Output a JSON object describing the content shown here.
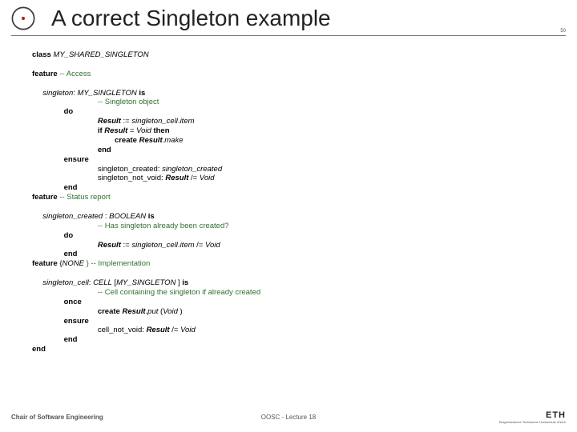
{
  "pagenum": "50",
  "title": "A correct Singleton example",
  "code": {
    "l1a": "class",
    "l1b": " MY_SHARED_SINGLETON",
    "l2a": "feature",
    "l2b": " -- Access",
    "l3a": "singleton",
    "l3b": ": ",
    "l3c": "MY_SINGLETON",
    "l3d": " ",
    "l3e": "is",
    "c1": "-- Singleton object",
    "do1": "do",
    "r1a": "Result",
    "r1b": " := ",
    "r1c": "singleton_cell",
    "r1d": ".",
    "r1e": "item",
    "r2a": "if",
    "r2b": " ",
    "r2c": "Result",
    "r2d": " = ",
    "r2e": "Void",
    "r2f": " ",
    "r2g": "then",
    "r3a": "create",
    "r3b": " ",
    "r3c": "Result",
    "r3d": ".",
    "r3e": "make",
    "r4": "end",
    "ens1": "ensure",
    "e1a": "singleton_created: ",
    "e1b": "singleton_created",
    "e2a": "singleton_not_void: ",
    "e2b": "Result",
    "e2c": " /= ",
    "e2d": "Void",
    "end1": "end",
    "f2a": "feature",
    "f2b": " -- Status report",
    "sc1a": "singleton_created",
    "sc1b": " : ",
    "sc1c": "BOOLEAN",
    "sc1d": " ",
    "sc1e": "is",
    "c2": "-- Has singleton already been created?",
    "do2": "do",
    "r5a": "Result",
    "r5b": " := ",
    "r5c": "singleton_cell",
    "r5d": ".",
    "r5e": "item",
    "r5f": " /= ",
    "r5g": "Void",
    "end2": "end",
    "f3a": "feature",
    "f3b": " {",
    "f3c": "NONE",
    "f3d": " } -- Implementation",
    "cell1a": "singleton_cell",
    "cell1b": ": ",
    "cell1c": "CELL",
    "cell1d": " [",
    "cell1e": "MY_SINGLETON",
    "cell1f": " ] ",
    "cell1g": "is",
    "c3": "-- Cell containing the singleton if already created",
    "once": "once",
    "r6a": "create",
    "r6b": " ",
    "r6c": "Result",
    "r6d": ".",
    "r6e": "put",
    "r6f": " (",
    "r6g": "Void",
    "r6h": " )",
    "ens2": "ensure",
    "e3a": "cell_not_void: ",
    "e3b": "Result",
    "e3c": " /= ",
    "e3d": "Void",
    "end3": "end",
    "end4": "end"
  },
  "footer": {
    "left": "Chair of Software Engineering",
    "center": "OOSC - Lecture 18"
  },
  "eth": {
    "main": "ETH",
    "sub": "Eidgenössische Technische Hochschule Zürich"
  }
}
